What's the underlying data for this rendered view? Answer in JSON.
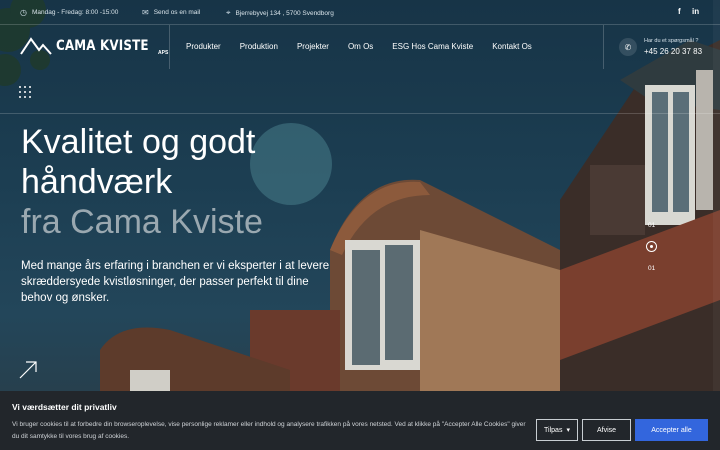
{
  "topbar": {
    "hours": "Mandag - Fredag: 8:00 -15:00",
    "email": "Send os en mail",
    "address": "Bjerrebyvej 134 , 5700 Svendborg",
    "social": [
      "f",
      "in"
    ]
  },
  "logo": {
    "name": "CAMA KVISTE",
    "suffix": "APS"
  },
  "nav": {
    "items": [
      "Produkter",
      "Produktion",
      "Projekter",
      "Om Os",
      "ESG Hos Cama Kviste",
      "Kontakt Os"
    ]
  },
  "contact": {
    "question": "Har du et spørgsmål ?",
    "phone": "+45 26 20 37 83"
  },
  "hero": {
    "line1": "Kvalitet og godt",
    "line2": "håndværk",
    "line3": "fra Cama Kviste",
    "subtitle": "Med mange års erfaring i branchen er vi eksperter i at levere skræddersyede kvistløsninger, der passer perfekt til dine behov og ønsker.",
    "slide_top": "01",
    "slide_bottom": "01"
  },
  "cookie": {
    "title": "Vi værdsætter dit privatliv",
    "text": "Vi bruger cookies til at forbedre din browseroplevelse, vise personlige reklamer eller indhold og analysere trafikken på vores netsted. Ved at klikke på \"Accepter Alle Cookies\" giver du dit samtykke til vores brug af cookies.",
    "customize": "Tilpas",
    "reject": "Afvise",
    "accept": "Accepter alle"
  },
  "colors": {
    "accent_button": "#3366dd",
    "cookie_bg": "#22262b",
    "hero_bg": "#1c3e52"
  }
}
